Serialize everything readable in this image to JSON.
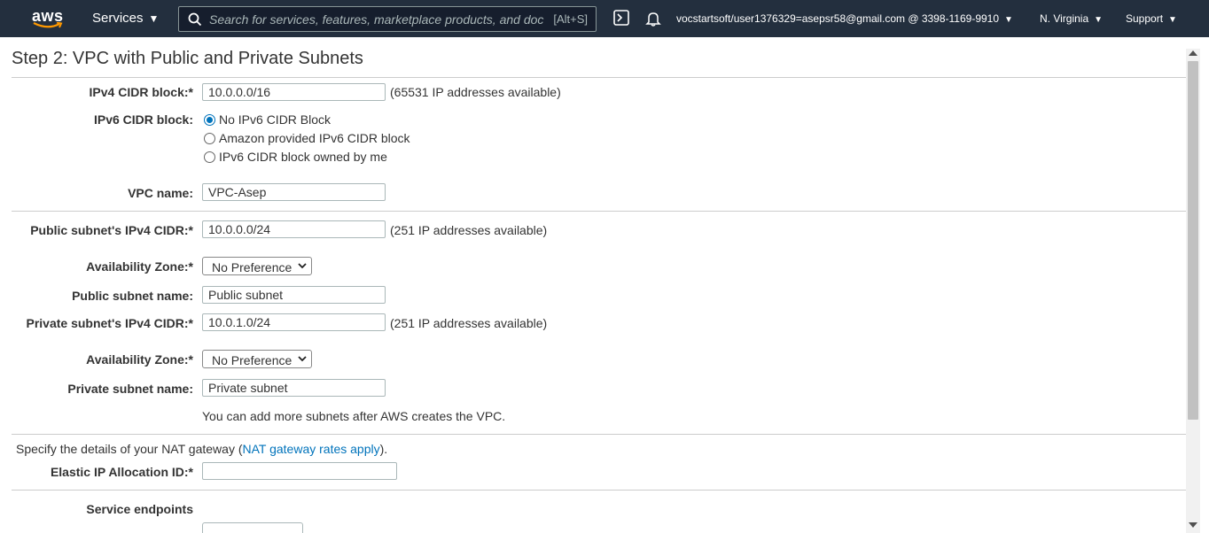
{
  "nav": {
    "logo_text": "aws",
    "services_label": "Services",
    "search_placeholder": "Search for services, features, marketplace products, and doc",
    "search_shortcut": "[Alt+S]",
    "account_label": "vocstartsoft/user1376329=asepsr58@gmail.com @ 3398-1169-9910",
    "region_label": "N. Virginia",
    "support_label": "Support"
  },
  "page": {
    "title": "Step 2: VPC with Public and Private Subnets"
  },
  "form": {
    "ipv4_cidr_label": "IPv4 CIDR block:*",
    "ipv4_cidr_value": "10.0.0.0/16",
    "ipv4_cidr_hint": "(65531 IP addresses available)",
    "ipv6_cidr_label": "IPv6 CIDR block:",
    "ipv6_options": [
      {
        "label": "No IPv6 CIDR Block",
        "selected": true
      },
      {
        "label": "Amazon provided IPv6 CIDR block",
        "selected": false
      },
      {
        "label": "IPv6 CIDR block owned by me",
        "selected": false
      }
    ],
    "vpc_name_label": "VPC name:",
    "vpc_name_value": "VPC-Asep",
    "public_cidr_label": "Public subnet's IPv4 CIDR:*",
    "public_cidr_value": "10.0.0.0/24",
    "public_cidr_hint": "(251 IP addresses available)",
    "az1_label": "Availability Zone:*",
    "az1_value": "No Preference",
    "public_name_label": "Public subnet name:",
    "public_name_value": "Public subnet",
    "private_cidr_label": "Private subnet's IPv4 CIDR:*",
    "private_cidr_value": "10.0.1.0/24",
    "private_cidr_hint": "(251 IP addresses available)",
    "az2_label": "Availability Zone:*",
    "az2_value": "No Preference",
    "private_name_label": "Private subnet name:",
    "private_name_value": "Private subnet",
    "more_subnets_note": "You can add more subnets after AWS creates the VPC.",
    "nat_prefix": "Specify the details of your NAT gateway (",
    "nat_link": "NAT gateway rates apply",
    "nat_suffix": ").",
    "eip_label": "Elastic IP Allocation ID:*",
    "eip_value": "",
    "service_endpoints_label": "Service endpoints"
  },
  "colors": {
    "nav_bg": "#232f3e",
    "link": "#0073bb",
    "aws_orange": "#ff9900"
  }
}
